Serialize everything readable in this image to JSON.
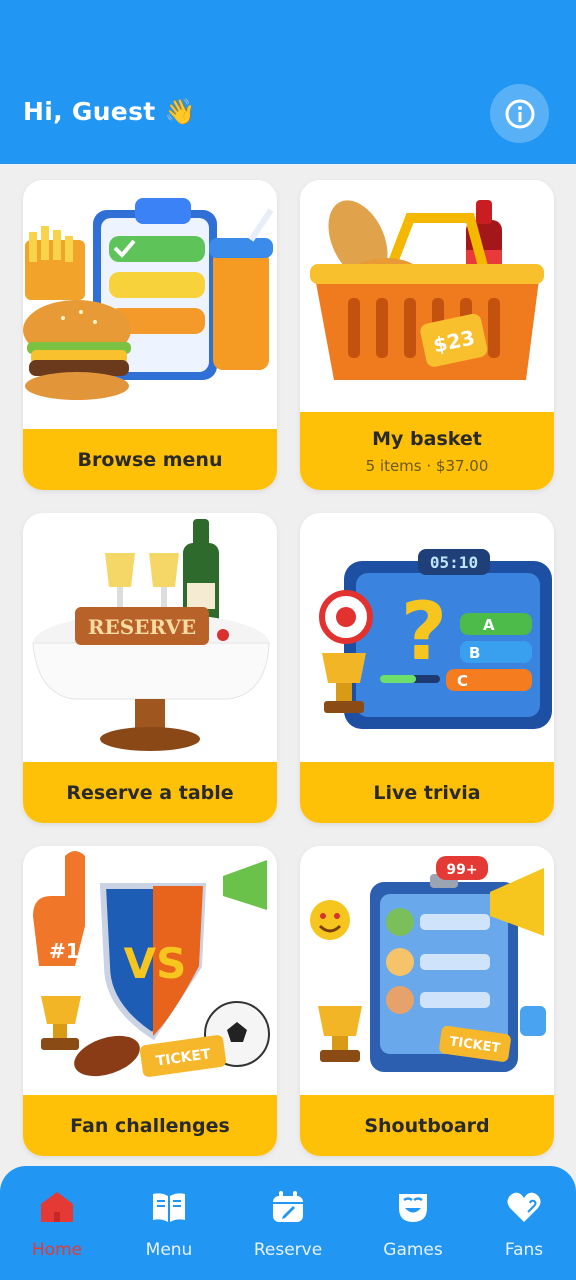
{
  "header": {
    "greeting": "Hi, Guest 👋",
    "info_icon": "info-icon"
  },
  "cards": [
    {
      "title": "Browse menu",
      "subtitle": ""
    },
    {
      "title": "My basket",
      "subtitle": "5 items · $37.00",
      "price_tag": "$23"
    },
    {
      "title": "Reserve a table",
      "subtitle": "",
      "sign": "RESERVE"
    },
    {
      "title": "Live trivia",
      "subtitle": "",
      "timer": "05:10",
      "options": [
        "A",
        "B",
        "C"
      ]
    },
    {
      "title": "Fan challenges",
      "subtitle": "",
      "badge": "#1",
      "vs": "VS",
      "ticket": "TICKET"
    },
    {
      "title": "Shoutboard",
      "subtitle": "",
      "notif": "99+",
      "ticket": "TICKET"
    }
  ],
  "nav": [
    {
      "label": "Home",
      "icon": "home-icon",
      "active": true
    },
    {
      "label": "Menu",
      "icon": "book-icon",
      "active": false
    },
    {
      "label": "Reserve",
      "icon": "calendar-icon",
      "active": false
    },
    {
      "label": "Games",
      "icon": "games-icon",
      "active": false
    },
    {
      "label": "Fans",
      "icon": "heart-icon",
      "active": false
    }
  ],
  "colors": {
    "primary": "#2196f3",
    "accent": "#ffc107",
    "active": "#e53935"
  }
}
